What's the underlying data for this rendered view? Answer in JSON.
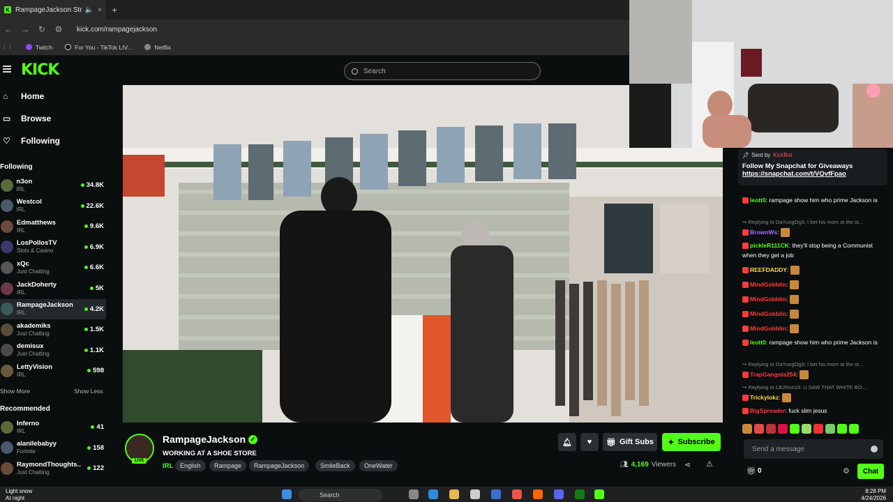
{
  "browser": {
    "tab_title": "RampageJackson Stream - ",
    "tab_close": "×",
    "new_tab": "+",
    "url": "kick.com/rampagejackson",
    "bookmarks": [
      "Twitch",
      "For You - TikTok LIV...",
      "Netflix"
    ]
  },
  "header": {
    "logo": "KICK",
    "search_placeholder": "Search"
  },
  "sidebar": {
    "nav": [
      "Home",
      "Browse",
      "Following"
    ],
    "following_title": "Following",
    "following": [
      {
        "name": "n3on",
        "category": "IRL",
        "viewers": "34.8K"
      },
      {
        "name": "Westcol",
        "category": "IRL",
        "viewers": "22.6K"
      },
      {
        "name": "Edmatthews",
        "category": "IRL",
        "viewers": "9.6K"
      },
      {
        "name": "LosPollosTV",
        "category": "Slots & Casino",
        "viewers": "6.9K"
      },
      {
        "name": "xQc",
        "category": "Just Chatting",
        "viewers": "6.6K"
      },
      {
        "name": "JackDoherty",
        "category": "IRL",
        "viewers": "5K"
      },
      {
        "name": "RampageJackson",
        "category": "IRL",
        "viewers": "4.2K"
      },
      {
        "name": "akademiks",
        "category": "Just Chatting",
        "viewers": "1.5K"
      },
      {
        "name": "demisux",
        "category": "Just Chatting",
        "viewers": "1.1K"
      },
      {
        "name": "LettyVision",
        "category": "IRL",
        "viewers": "598"
      }
    ],
    "show_more": "Show More",
    "show_less": "Show Less",
    "recommended_title": "Recommended",
    "recommended": [
      {
        "name": "Inferno",
        "category": "IRL",
        "viewers": "41"
      },
      {
        "name": "alanilebabyy",
        "category": "Fortnite",
        "viewers": "158"
      },
      {
        "name": "RaymondThoughts...",
        "category": "Just Chatting",
        "viewers": "122"
      }
    ]
  },
  "stream": {
    "live_badge": "LIVE",
    "streamer": "RampageJackson",
    "title": "WORKING AT A SHOE STORE",
    "category": "IRL",
    "tags": [
      "English",
      "Rampage",
      "RampageJackson",
      "SmileBack",
      "OneWater"
    ],
    "gift_subs": "Gift Subs",
    "subscribe": "Subscribe",
    "viewers_count": "4,169",
    "viewers_label": "Viewers"
  },
  "chat": {
    "pinned": {
      "sent_by": "Sent by",
      "sender": "KickBot",
      "message": "Follow My Snapchat for Giveaways",
      "link": "https://snapchat.com/t/VQvfFpao"
    },
    "messages": [
      {
        "reply": "",
        "user": "leott0",
        "user_color": "#53fc18",
        "text": "rampage show him who prime Jackson is"
      },
      {
        "reply": "Replying to DaYungOg3: I bet his mom at the st...",
        "user": "BrownWs",
        "user_color": "#a66cff",
        "text": ""
      },
      {
        "reply": "",
        "user": "pickleR111CK",
        "user_color": "#53fc18",
        "text": "they'll stop being a Communist when they get a job"
      },
      {
        "reply": "",
        "user": "REEFDADDY",
        "user_color": "#ffd84d",
        "text": ""
      },
      {
        "reply": "",
        "user": "MindGobblin",
        "user_color": "#ff3b3b",
        "text": ""
      },
      {
        "reply": "",
        "user": "MindGobblin",
        "user_color": "#ff3b3b",
        "text": ""
      },
      {
        "reply": "",
        "user": "MindGobblin",
        "user_color": "#ff3b3b",
        "text": ""
      },
      {
        "reply": "",
        "user": "MindGobblin",
        "user_color": "#ff3b3b",
        "text": ""
      },
      {
        "reply": "",
        "user": "leott0",
        "user_color": "#53fc18",
        "text": "rampage show him who prime Jackson is"
      },
      {
        "reply": "Replying to DaYungOg3: I bet his mom at the st...",
        "user": "TrapGangsta254",
        "user_color": "#ff3b3b",
        "text": ""
      },
      {
        "reply": "Replying to LBJRon19: U SAW THAT WHITE BO...",
        "user": "Trickylokz",
        "user_color": "#ffd84d",
        "text": ""
      },
      {
        "reply": "",
        "user": "BigSpreader",
        "user_color": "#ff3b3b",
        "text": "fuck slim jesus"
      }
    ],
    "input_placeholder": "Send a message",
    "points": "0",
    "chat_button": "Chat"
  },
  "taskbar": {
    "weather_title": "Light snow",
    "weather_sub": "At night",
    "search": "Search",
    "time": "8:28 PM",
    "date": "4/24/2026"
  },
  "colors": {
    "accent": "#53fc18",
    "background": "#0b0e0f"
  }
}
